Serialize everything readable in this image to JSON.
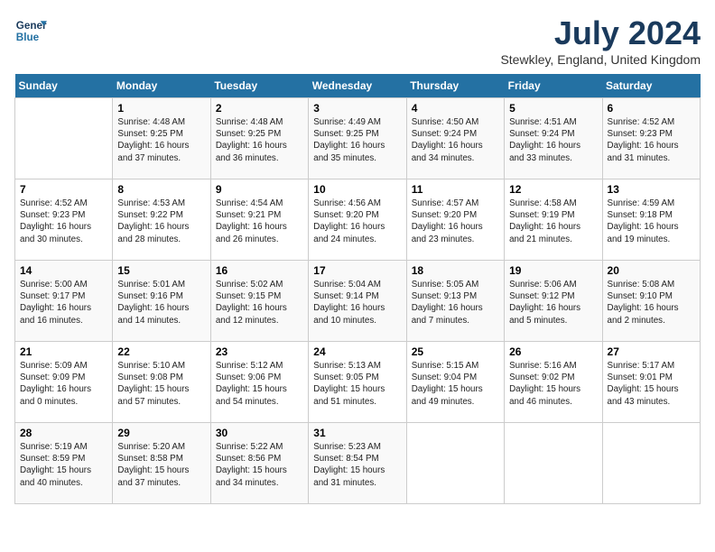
{
  "header": {
    "logo_line1": "General",
    "logo_line2": "Blue",
    "month_title": "July 2024",
    "location": "Stewkley, England, United Kingdom"
  },
  "days_of_week": [
    "Sunday",
    "Monday",
    "Tuesday",
    "Wednesday",
    "Thursday",
    "Friday",
    "Saturday"
  ],
  "weeks": [
    [
      {
        "num": "",
        "info": ""
      },
      {
        "num": "1",
        "info": "Sunrise: 4:48 AM\nSunset: 9:25 PM\nDaylight: 16 hours\nand 37 minutes."
      },
      {
        "num": "2",
        "info": "Sunrise: 4:48 AM\nSunset: 9:25 PM\nDaylight: 16 hours\nand 36 minutes."
      },
      {
        "num": "3",
        "info": "Sunrise: 4:49 AM\nSunset: 9:25 PM\nDaylight: 16 hours\nand 35 minutes."
      },
      {
        "num": "4",
        "info": "Sunrise: 4:50 AM\nSunset: 9:24 PM\nDaylight: 16 hours\nand 34 minutes."
      },
      {
        "num": "5",
        "info": "Sunrise: 4:51 AM\nSunset: 9:24 PM\nDaylight: 16 hours\nand 33 minutes."
      },
      {
        "num": "6",
        "info": "Sunrise: 4:52 AM\nSunset: 9:23 PM\nDaylight: 16 hours\nand 31 minutes."
      }
    ],
    [
      {
        "num": "7",
        "info": "Sunrise: 4:52 AM\nSunset: 9:23 PM\nDaylight: 16 hours\nand 30 minutes."
      },
      {
        "num": "8",
        "info": "Sunrise: 4:53 AM\nSunset: 9:22 PM\nDaylight: 16 hours\nand 28 minutes."
      },
      {
        "num": "9",
        "info": "Sunrise: 4:54 AM\nSunset: 9:21 PM\nDaylight: 16 hours\nand 26 minutes."
      },
      {
        "num": "10",
        "info": "Sunrise: 4:56 AM\nSunset: 9:20 PM\nDaylight: 16 hours\nand 24 minutes."
      },
      {
        "num": "11",
        "info": "Sunrise: 4:57 AM\nSunset: 9:20 PM\nDaylight: 16 hours\nand 23 minutes."
      },
      {
        "num": "12",
        "info": "Sunrise: 4:58 AM\nSunset: 9:19 PM\nDaylight: 16 hours\nand 21 minutes."
      },
      {
        "num": "13",
        "info": "Sunrise: 4:59 AM\nSunset: 9:18 PM\nDaylight: 16 hours\nand 19 minutes."
      }
    ],
    [
      {
        "num": "14",
        "info": "Sunrise: 5:00 AM\nSunset: 9:17 PM\nDaylight: 16 hours\nand 16 minutes."
      },
      {
        "num": "15",
        "info": "Sunrise: 5:01 AM\nSunset: 9:16 PM\nDaylight: 16 hours\nand 14 minutes."
      },
      {
        "num": "16",
        "info": "Sunrise: 5:02 AM\nSunset: 9:15 PM\nDaylight: 16 hours\nand 12 minutes."
      },
      {
        "num": "17",
        "info": "Sunrise: 5:04 AM\nSunset: 9:14 PM\nDaylight: 16 hours\nand 10 minutes."
      },
      {
        "num": "18",
        "info": "Sunrise: 5:05 AM\nSunset: 9:13 PM\nDaylight: 16 hours\nand 7 minutes."
      },
      {
        "num": "19",
        "info": "Sunrise: 5:06 AM\nSunset: 9:12 PM\nDaylight: 16 hours\nand 5 minutes."
      },
      {
        "num": "20",
        "info": "Sunrise: 5:08 AM\nSunset: 9:10 PM\nDaylight: 16 hours\nand 2 minutes."
      }
    ],
    [
      {
        "num": "21",
        "info": "Sunrise: 5:09 AM\nSunset: 9:09 PM\nDaylight: 16 hours\nand 0 minutes."
      },
      {
        "num": "22",
        "info": "Sunrise: 5:10 AM\nSunset: 9:08 PM\nDaylight: 15 hours\nand 57 minutes."
      },
      {
        "num": "23",
        "info": "Sunrise: 5:12 AM\nSunset: 9:06 PM\nDaylight: 15 hours\nand 54 minutes."
      },
      {
        "num": "24",
        "info": "Sunrise: 5:13 AM\nSunset: 9:05 PM\nDaylight: 15 hours\nand 51 minutes."
      },
      {
        "num": "25",
        "info": "Sunrise: 5:15 AM\nSunset: 9:04 PM\nDaylight: 15 hours\nand 49 minutes."
      },
      {
        "num": "26",
        "info": "Sunrise: 5:16 AM\nSunset: 9:02 PM\nDaylight: 15 hours\nand 46 minutes."
      },
      {
        "num": "27",
        "info": "Sunrise: 5:17 AM\nSunset: 9:01 PM\nDaylight: 15 hours\nand 43 minutes."
      }
    ],
    [
      {
        "num": "28",
        "info": "Sunrise: 5:19 AM\nSunset: 8:59 PM\nDaylight: 15 hours\nand 40 minutes."
      },
      {
        "num": "29",
        "info": "Sunrise: 5:20 AM\nSunset: 8:58 PM\nDaylight: 15 hours\nand 37 minutes."
      },
      {
        "num": "30",
        "info": "Sunrise: 5:22 AM\nSunset: 8:56 PM\nDaylight: 15 hours\nand 34 minutes."
      },
      {
        "num": "31",
        "info": "Sunrise: 5:23 AM\nSunset: 8:54 PM\nDaylight: 15 hours\nand 31 minutes."
      },
      {
        "num": "",
        "info": ""
      },
      {
        "num": "",
        "info": ""
      },
      {
        "num": "",
        "info": ""
      }
    ]
  ]
}
